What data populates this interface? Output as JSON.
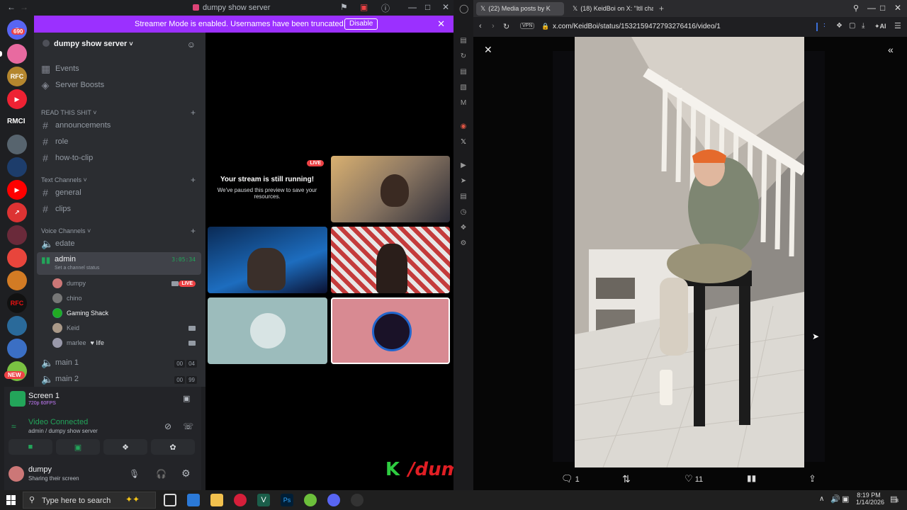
{
  "discord": {
    "window_title": "dumpy show server",
    "guild_badge": "690",
    "guild_rmci": "RMCI",
    "guild_new": "NEW",
    "banner": {
      "message": "Streamer Mode is enabled. Usernames have been truncated.",
      "disable_label": "Disable"
    },
    "server_name": "dumpy show server",
    "top_items": [
      {
        "label": "Events"
      },
      {
        "label": "Server Boosts"
      }
    ],
    "categories": {
      "read": "READ THIS SHIT",
      "text": "Text Channels",
      "voice": "Voice Channels"
    },
    "read_channels": [
      "announcements",
      "role",
      "how-to-clip"
    ],
    "text_channels": [
      "general",
      "clips"
    ],
    "voice": {
      "edate": "edate",
      "admin": "admin",
      "admin_timer": "3:05:34",
      "admin_status": "Set a channel status",
      "users": [
        {
          "name": "dumpy",
          "badge": "LIVE",
          "color": "#c77"
        },
        {
          "name": "chino",
          "color": "#777"
        },
        {
          "name": "Gaming Shack",
          "color": "#2a2"
        },
        {
          "name": "Keid",
          "color": "#a98"
        },
        {
          "name": "marlee",
          "tag": "life",
          "color": "#99a"
        }
      ],
      "main1": "main 1",
      "main1_counts": [
        "00",
        "04"
      ],
      "main2": "main 2",
      "main2_counts": [
        "00",
        "99"
      ]
    },
    "screen": {
      "title": "Screen 1",
      "quality": "720p 60FPS"
    },
    "connection": {
      "status": "Video Connected",
      "detail": "admin / dumpy show server"
    },
    "user": {
      "name": "dumpy",
      "status": "Sharing their screen"
    },
    "stream_paused": {
      "badge": "LIVE",
      "title": "Your stream is still running!",
      "body": "We've paused this preview to save your resources."
    },
    "overlay_text": "/dumpylive",
    "overlay_k": "K"
  },
  "browser": {
    "tabs": [
      {
        "label": "(22) Media posts by K"
      },
      {
        "label": "(18) KeidBoi on X: \"Itll cha"
      }
    ],
    "vpn": "VPN",
    "url": "x.com/KeidBoi/status/1532159472793276416/video/1",
    "ai_label": "AI",
    "actions": {
      "replies": "1",
      "likes": "11"
    }
  },
  "taskbar": {
    "search_placeholder": "Type here to search",
    "time": "8:19 PM",
    "date": "1/14/2026",
    "notif": "8"
  },
  "colors": {
    "blurple": "#9b30ff",
    "green": "#23a55a",
    "live_red": "#ed4245",
    "discord_bg": "#2b2d31"
  }
}
